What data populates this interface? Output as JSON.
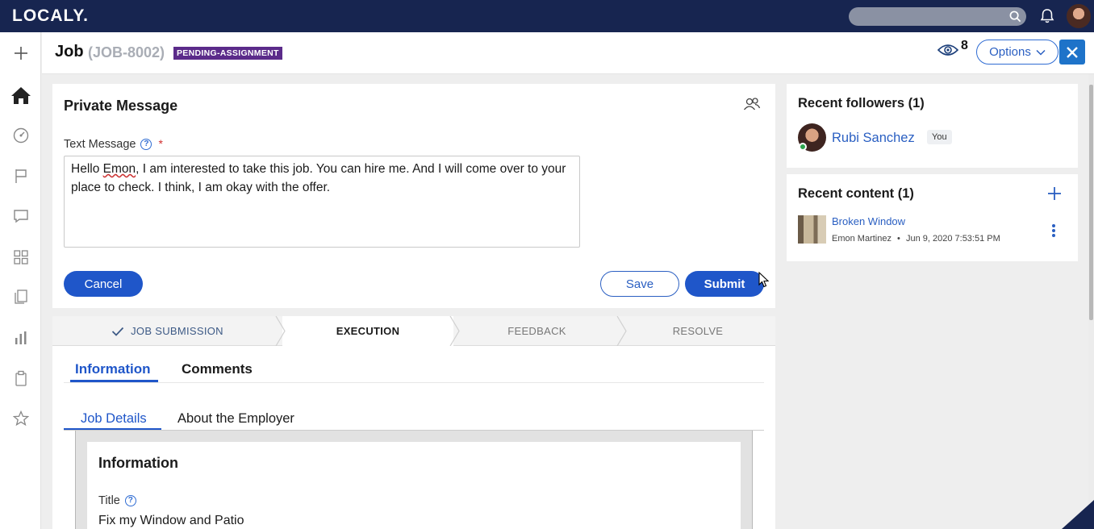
{
  "app": {
    "brand": "LOCALY."
  },
  "topbar": {
    "search_placeholder": ""
  },
  "header": {
    "title": "Job",
    "job_id": "(JOB-8002)",
    "status": "PENDING-ASSIGNMENT",
    "followers_count": "8",
    "options_label": "Options"
  },
  "private_message": {
    "title": "Private Message",
    "field_label": "Text Message",
    "required_mark": "*",
    "message_parts": [
      "Hello ",
      "Emon",
      ", I am interested to take this job. You can hire me. And I will come over to your place to check. I think, I am okay with the offer."
    ],
    "cancel_label": "Cancel",
    "save_label": "Save",
    "submit_label": "Submit"
  },
  "stages": [
    {
      "label": "JOB SUBMISSION",
      "state": "done"
    },
    {
      "label": "EXECUTION",
      "state": "active"
    },
    {
      "label": "FEEDBACK",
      "state": "future"
    },
    {
      "label": "RESOLVE",
      "state": "future"
    }
  ],
  "tabs": [
    {
      "label": "Information",
      "active": true
    },
    {
      "label": "Comments",
      "active": false
    }
  ],
  "subtabs": [
    {
      "label": "Job Details",
      "active": true
    },
    {
      "label": "About the Employer",
      "active": false
    }
  ],
  "information": {
    "title": "Information",
    "title_label": "Title",
    "title_value": "Fix my Window and Patio"
  },
  "followers_panel": {
    "title": "Recent followers (1)",
    "follower_name": "Rubi Sanchez",
    "you_badge": "You"
  },
  "content_panel": {
    "title": "Recent content (1)",
    "item_title": "Broken Window",
    "item_author": "Emon Martinez",
    "item_separator": "•",
    "item_date": "Jun 9, 2020 7:53:51 PM"
  },
  "colors": {
    "topbar": "#172550",
    "primary": "#1f56c9",
    "status_badge": "#5b2b8a",
    "close_button": "#1e73c9"
  }
}
